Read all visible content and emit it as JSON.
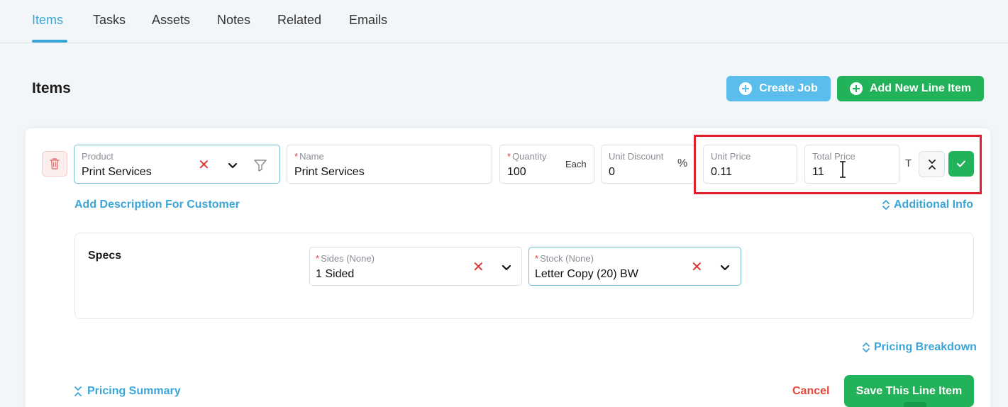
{
  "tabs": [
    {
      "label": "Items",
      "active": true
    },
    {
      "label": "Tasks"
    },
    {
      "label": "Assets"
    },
    {
      "label": "Notes"
    },
    {
      "label": "Related"
    },
    {
      "label": "Emails"
    }
  ],
  "section_title": "Items",
  "actions": {
    "create_job": "Create Job",
    "add_line_item": "Add New Line Item"
  },
  "line_item": {
    "product": {
      "label": "Product",
      "value": "Print Services"
    },
    "name": {
      "label": "Name",
      "value": "Print Services"
    },
    "quantity": {
      "label": "Quantity",
      "value": "100",
      "unit": "Each"
    },
    "unit_discount": {
      "label": "Unit Discount",
      "value": "0",
      "suffix": "%"
    },
    "unit_price": {
      "label": "Unit Price",
      "value": "0.11"
    },
    "total_price": {
      "label": "Total Price",
      "value": "11"
    },
    "t_label": "T"
  },
  "links": {
    "add_description": "Add Description For Customer",
    "additional_info": "Additional Info",
    "pricing_breakdown": "Pricing Breakdown",
    "pricing_summary": "Pricing Summary"
  },
  "specs": {
    "title": "Specs",
    "sides": {
      "label": "Sides (None)",
      "value": "1 Sided"
    },
    "stock": {
      "label": "Stock (None)",
      "value": "Letter Copy (20) BW"
    }
  },
  "footer": {
    "cancel": "Cancel",
    "save": "Save This Line Item"
  },
  "colors": {
    "accent": "#3aa6d8",
    "primary_green": "#22b35a",
    "create_blue": "#5bbdeb",
    "danger": "#e0483a",
    "highlight": "#e0202a"
  }
}
